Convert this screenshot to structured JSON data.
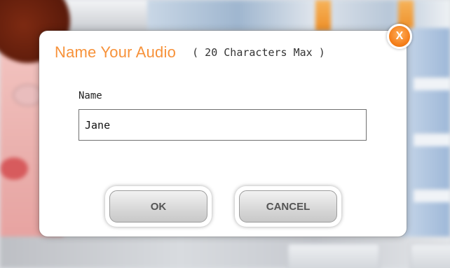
{
  "dialog": {
    "title": "Name Your Audio",
    "subtitle": "( 20 Characters Max )",
    "close_label": "X",
    "name_label": "Name",
    "name_value": "Jane",
    "ok_label": "OK",
    "cancel_label": "CANCEL"
  },
  "colors": {
    "accent": "#f7923a",
    "close_button": "#f47d18"
  },
  "icons": {
    "close": "close-icon"
  }
}
